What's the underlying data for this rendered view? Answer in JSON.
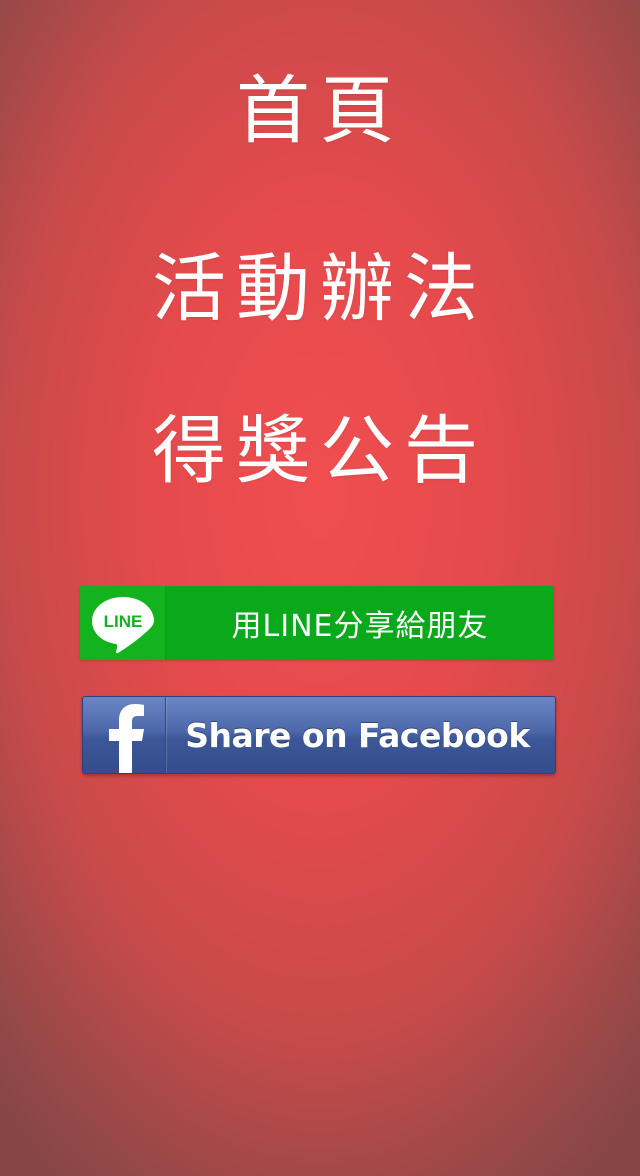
{
  "menu": {
    "home": "首頁",
    "rules": "活動辦法",
    "winners": "得獎公告"
  },
  "line_share": {
    "logo_text": "LINE",
    "label": "用LINE分享給朋友",
    "icon": "line-logo-icon",
    "color": "#0aa91c"
  },
  "facebook_share": {
    "label": "Share on Facebook",
    "icon": "facebook-f-icon",
    "color": "#3b5998"
  },
  "colors": {
    "background_center": "#f04e50",
    "background_edge": "#864646",
    "text": "#ffffff"
  }
}
